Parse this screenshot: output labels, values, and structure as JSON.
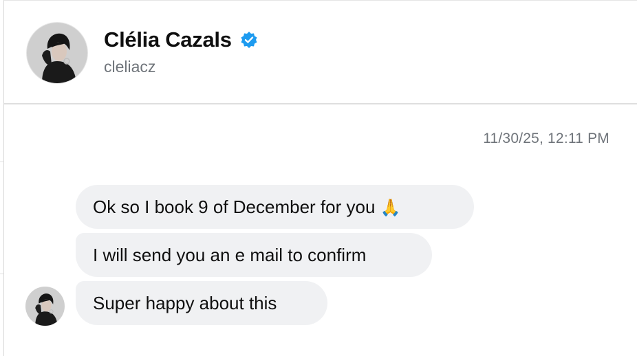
{
  "profile": {
    "name": "Clélia Cazals",
    "handle": "cleliacz",
    "verified": true,
    "avatar_icon": "profile-photo"
  },
  "conversation": {
    "timestamp": "11/30/25, 12:11 PM",
    "messages": [
      {
        "text": "Ok so I book 9 of December for you",
        "emoji": "🙏"
      },
      {
        "text": "I will send you an e mail to confirm",
        "emoji": ""
      },
      {
        "text": "Super happy about this",
        "emoji": ""
      }
    ]
  },
  "colors": {
    "verified_badge": "#1d9bf0",
    "bubble_bg": "#f0f1f3",
    "muted_text": "#6f747a"
  }
}
